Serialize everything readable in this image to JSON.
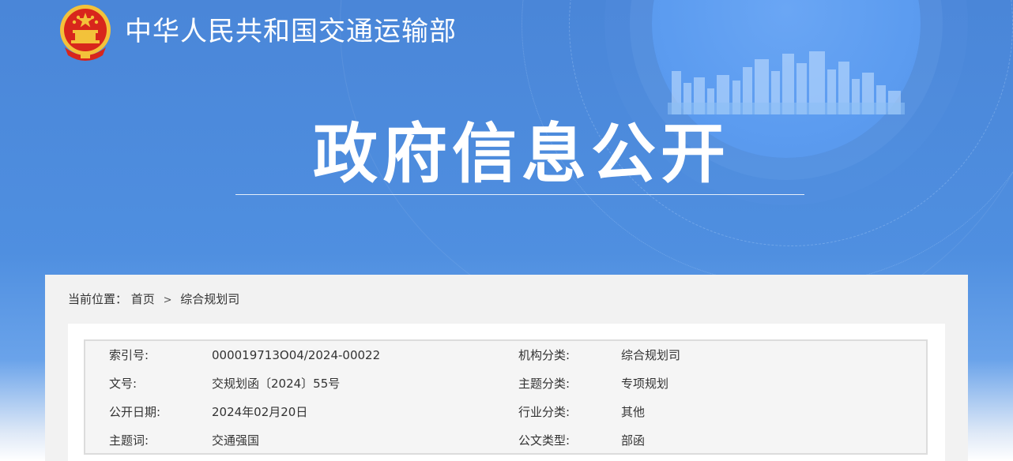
{
  "header": {
    "ministry_name": "中华人民共和国交通运输部",
    "section_title": "政府信息公开"
  },
  "breadcrumb": {
    "prefix": "当前位置：",
    "items": [
      "首页",
      "综合规划司"
    ],
    "separator": ">"
  },
  "metadata": [
    {
      "label": "索引号:",
      "value": "000019713O04/2024-00022",
      "label2": "机构分类:",
      "value2": "综合规划司"
    },
    {
      "label": "文号:",
      "value": "交规划函〔2024〕55号",
      "label2": "主题分类:",
      "value2": "专项规划"
    },
    {
      "label": "公开日期:",
      "value": "2024年02月20日",
      "label2": "行业分类:",
      "value2": "其他"
    },
    {
      "label": "主题词:",
      "value": "交通强国",
      "label2": "公文类型:",
      "value2": "部函"
    }
  ],
  "colors": {
    "banner_blue": "#4f8fe0",
    "emblem_red": "#d8261c",
    "emblem_gold": "#f3c23a",
    "panel_bg": "#f2f2f2"
  },
  "icons": {
    "emblem": "national-emblem-icon"
  }
}
